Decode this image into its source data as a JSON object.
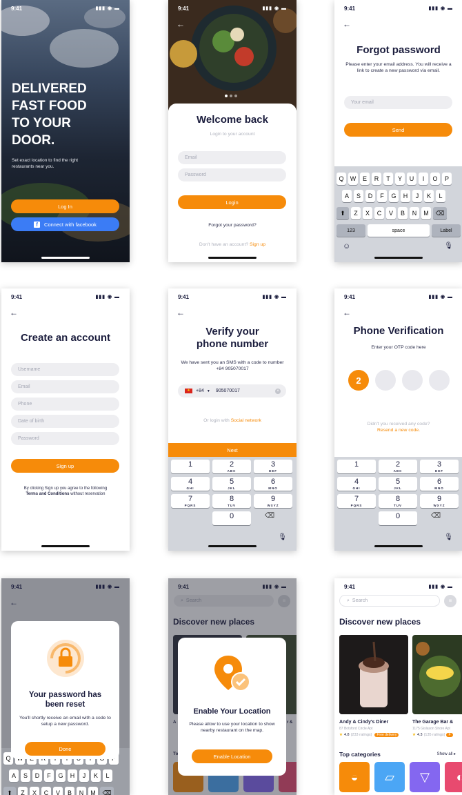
{
  "status_time": "9:41",
  "onboarding": {
    "headline": [
      "DELIVERED",
      "FAST FOOD",
      "TO YOUR",
      "DOOR."
    ],
    "tagline": "Set exact location to find the right restaurants near you.",
    "login_button": "Log In",
    "facebook_button": "Connect with facebook"
  },
  "welcome": {
    "title": "Welcome back",
    "subtitle": "Login to your account",
    "email_placeholder": "Email",
    "password_placeholder": "Password",
    "login_button": "Login",
    "forgot": "Forgot your password?",
    "no_account": "Don't have an account?",
    "signup": "Sign up"
  },
  "forgot": {
    "title": "Forgot password",
    "description": "Please enter your email address. You will receive a link to create a new password via email.",
    "email_placeholder": "Your email",
    "send_button": "Send"
  },
  "keyboard": {
    "row1": [
      "Q",
      "W",
      "E",
      "R",
      "T",
      "Y",
      "U",
      "I",
      "O",
      "P"
    ],
    "row2": [
      "A",
      "S",
      "D",
      "F",
      "G",
      "H",
      "J",
      "K",
      "L"
    ],
    "row3": [
      "Z",
      "X",
      "C",
      "V",
      "B",
      "N",
      "M"
    ],
    "num_key": "123",
    "space_key": "space",
    "return_key": "Label"
  },
  "create": {
    "title": "Create an account",
    "fields": [
      "Username",
      "Email",
      "Phone",
      "Date of birth",
      "Password"
    ],
    "signup_button": "Sign up",
    "terms_prefix": "By clicking Sign up you agree to the following",
    "terms_link": "Terms and Conditions",
    "terms_suffix": "without reservation"
  },
  "verify": {
    "title_line1": "Verify your",
    "title_line2": "phone number",
    "message": "We have sent you an SMS with a code to number +84 905070017",
    "country_code": "+84",
    "phone_value": "905070017",
    "or_login": "Or login with",
    "social_link": "Social network",
    "next_button": "Next"
  },
  "numpad": [
    {
      "n": "1",
      "l": ""
    },
    {
      "n": "2",
      "l": "ABC"
    },
    {
      "n": "3",
      "l": "DEF"
    },
    {
      "n": "4",
      "l": "GHI"
    },
    {
      "n": "5",
      "l": "JKL"
    },
    {
      "n": "6",
      "l": "MNO"
    },
    {
      "n": "7",
      "l": "PQRS"
    },
    {
      "n": "8",
      "l": "TUV"
    },
    {
      "n": "9",
      "l": "WXYZ"
    },
    {
      "n": "0",
      "l": ""
    }
  ],
  "otp": {
    "title": "Phone Verification",
    "subtitle": "Enter your OTP code here",
    "digit1": "2",
    "didnt_receive": "Didn't you received any code?",
    "resend": "Resend a new code."
  },
  "reset": {
    "title_line1": "Your password has",
    "title_line2": "been reset",
    "message": "You'll shortly receive an email with a code to setup a new password.",
    "done_button": "Done"
  },
  "location": {
    "search_placeholder": "Search",
    "section_title": "Discover new places",
    "title": "Enable Your Location",
    "message": "Please allow to use your location to show nearby restaurant on the map.",
    "enable_button": "Enable Location",
    "peek_a": "A",
    "peek_r": "r &",
    "peek_to": "To"
  },
  "discover": {
    "search_placeholder": "Search",
    "section_title": "Discover new places",
    "places": [
      {
        "name": "Andy & Cindy's Diner",
        "address": "87 Botsford Circle Apt",
        "rating": "4.8",
        "ratings_count": "(233 ratings)",
        "badge": "Free delivery"
      },
      {
        "name": "The Garage Bar &",
        "address": "1175 Gislason Shore Apt",
        "rating": "4.3",
        "ratings_count": "(135 ratings)",
        "badge": "F"
      }
    ],
    "top_categories": "Top categories",
    "show_all": "Show all ▸",
    "category_colors": [
      "#f68b0a",
      "#4ba6f5",
      "#8467f0",
      "#e84a6f"
    ]
  },
  "colors": {
    "accent": "#f68b0a",
    "facebook": "#3b7cf5",
    "navy": "#1b1d3d"
  }
}
